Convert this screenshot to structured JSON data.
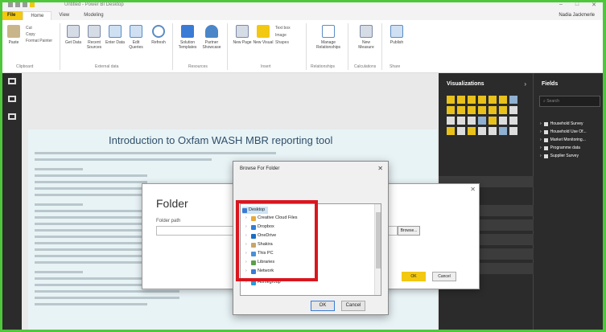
{
  "window": {
    "title": "Untitled - Power BI Desktop",
    "user": "Nadia Jackmerle"
  },
  "tabs": [
    "File",
    "Home",
    "View",
    "Modeling"
  ],
  "ribbon": {
    "buttons": [
      {
        "label": "Paste",
        "icon": "paste-icon"
      },
      {
        "label": "Get Data",
        "icon": "get-data-icon"
      },
      {
        "label": "Recent Sources",
        "icon": "recent-sources-icon"
      },
      {
        "label": "Enter Data",
        "icon": "enter-data-icon"
      },
      {
        "label": "Edit Queries",
        "icon": "edit-queries-icon"
      },
      {
        "label": "Refresh",
        "icon": "refresh-icon"
      },
      {
        "label": "Solution Templates",
        "icon": "solution-templates-icon"
      },
      {
        "label": "Partner Showcase",
        "icon": "partner-showcase-icon"
      },
      {
        "label": "New Page",
        "icon": "new-page-icon"
      },
      {
        "label": "New Visual",
        "icon": "new-visual-icon"
      },
      {
        "label": "Manage Relationships",
        "icon": "manage-relationships-icon"
      },
      {
        "label": "New Measure",
        "icon": "new-measure-icon"
      },
      {
        "label": "Publish",
        "icon": "publish-icon"
      }
    ],
    "clipboard": [
      "Cut",
      "Copy",
      "Format Painter"
    ],
    "insert_small": [
      "Text box",
      "Image",
      "Shapes"
    ],
    "groups": [
      "Clipboard",
      "External data",
      "Resources",
      "Insert",
      "Relationships",
      "Calculations",
      "Share"
    ]
  },
  "report": {
    "title": "Introduction to Oxfam WASH MBR reporting tool"
  },
  "visualizations": {
    "header": "Visualizations"
  },
  "fields": {
    "header": "Fields",
    "search_placeholder": "Search",
    "items": [
      "Household Survey",
      "Household Use Of...",
      "Market Monitoring...",
      "Programme data",
      "Supplier Survey"
    ]
  },
  "folder_dialog": {
    "heading": "Folder",
    "path_label": "Folder path",
    "browse_label": "Browse...",
    "ok_label": "OK",
    "cancel_label": "Cancel"
  },
  "browse_dialog": {
    "title": "Browse For Folder",
    "tree": [
      {
        "label": "Desktop",
        "icon": "desktop-icon",
        "level": 0,
        "selected": true
      },
      {
        "label": "Creative Cloud Files",
        "icon": "creative-cloud-icon",
        "level": 1
      },
      {
        "label": "Dropbox",
        "icon": "dropbox-icon",
        "level": 1
      },
      {
        "label": "OneDrive",
        "icon": "onedrive-icon",
        "level": 1
      },
      {
        "label": "Shakira",
        "icon": "user-folder-icon",
        "level": 1
      },
      {
        "label": "This PC",
        "icon": "computer-icon",
        "level": 1
      },
      {
        "label": "Libraries",
        "icon": "libraries-icon",
        "level": 1
      },
      {
        "label": "Network",
        "icon": "network-icon",
        "level": 1
      },
      {
        "label": "Homegroup",
        "icon": "homegroup-icon",
        "level": 1
      }
    ],
    "ok_label": "OK",
    "cancel_label": "Cancel"
  },
  "colors": {
    "accent": "#f2c811",
    "frame": "#4ec83a",
    "highlight": "#d9161f",
    "pane": "#2b2b2b"
  }
}
